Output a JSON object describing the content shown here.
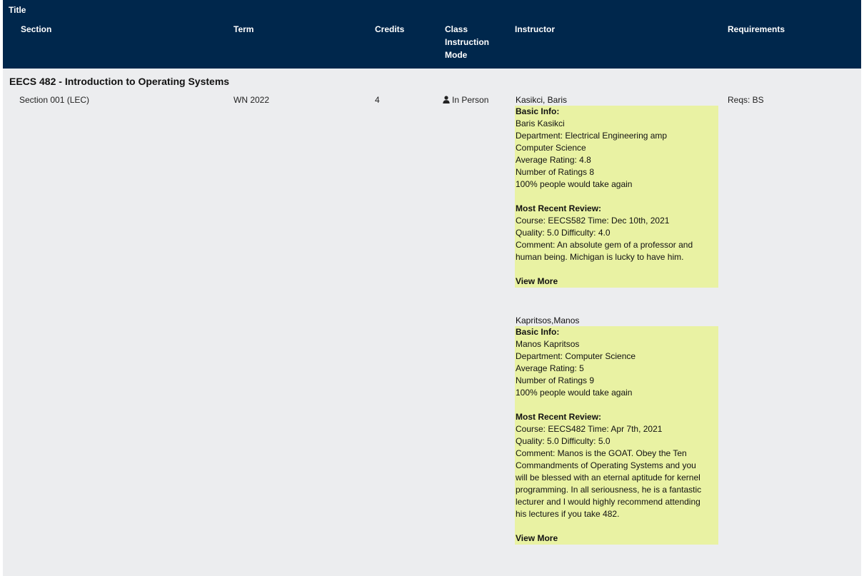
{
  "header": {
    "title": "Title",
    "section": "Section",
    "term": "Term",
    "credits": "Credits",
    "mode": [
      "Class",
      "Instruction",
      "Mode"
    ],
    "instructor": "Instructor",
    "requirements": "Requirements"
  },
  "course": {
    "title": "EECS 482 - Introduction to Operating Systems",
    "section": "Section 001 (LEC)",
    "term": "WN 2022",
    "credits": "4",
    "mode": "In Person",
    "requirements": "Reqs: BS",
    "mode_icon": "person-icon"
  },
  "instructors": [
    {
      "name": "Kasikci, Baris",
      "basic_label": "Basic Info:",
      "full_name": "Baris Kasikci",
      "department": [
        "Department: Electrical Engineering amp",
        "Computer Science"
      ],
      "avg_rating": "Average Rating: 4.8",
      "num_ratings": "Number of Ratings 8",
      "take_again": "100% people would take again",
      "review_label": "Most Recent Review:",
      "course_time": "Course: EECS582 Time: Dec 10th, 2021",
      "quality": "Quality: 5.0 Difficulty: 4.0",
      "comment": [
        "Comment: An absolute gem of a professor and",
        "human being. Michigan is lucky to have him."
      ],
      "view_more": "View More"
    },
    {
      "name": "Kapritsos,Manos",
      "basic_label": "Basic Info:",
      "full_name": "Manos Kapritsos",
      "department": [
        "Department: Computer Science"
      ],
      "avg_rating": "Average Rating: 5",
      "num_ratings": "Number of Ratings 9",
      "take_again": "100% people would take again",
      "review_label": "Most Recent Review:",
      "course_time": "Course: EECS482 Time: Apr 7th, 2021",
      "quality": "Quality: 5.0 Difficulty: 5.0",
      "comment": [
        "Comment: Manos is the GOAT. Obey the Ten",
        "Commandments of Operating Systems and you",
        "will be blessed with an eternal aptitude for kernel",
        "programming. In all seriousness, he is a fantastic",
        "lecturer and I would highly recommend attending",
        "his lectures if you take 482."
      ],
      "view_more": "View More"
    }
  ],
  "colors": {
    "header_bg": "#00274c",
    "card_bg": "#e9f2a3",
    "page_bg": "#ecedef"
  }
}
